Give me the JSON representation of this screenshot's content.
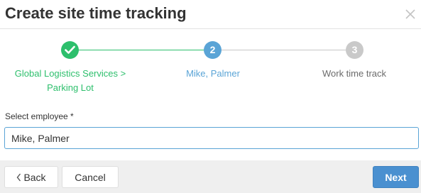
{
  "dialog": {
    "title": "Create site time tracking",
    "close_icon": "close-icon"
  },
  "stepper": {
    "steps": [
      {
        "number": "1",
        "label": "Global Logistics Services > Parking Lot",
        "state": "completed",
        "icon": "check-icon",
        "color": "#2dbf6c"
      },
      {
        "number": "2",
        "label": "Mike, Palmer",
        "state": "active",
        "color": "#5aa4d6"
      },
      {
        "number": "3",
        "label": "Work time track",
        "state": "pending",
        "color": "#c9c9c9"
      }
    ]
  },
  "form": {
    "employee_label": "Select employee *",
    "employee_value": "Mike, Palmer"
  },
  "footer": {
    "back_label": "Back",
    "back_icon": "chevron-left-icon",
    "cancel_label": "Cancel",
    "next_label": "Next"
  },
  "colors": {
    "accent": "#4a90d0",
    "success": "#2dbf6c",
    "active_step": "#5aa4d6",
    "pending_step": "#c9c9c9"
  }
}
